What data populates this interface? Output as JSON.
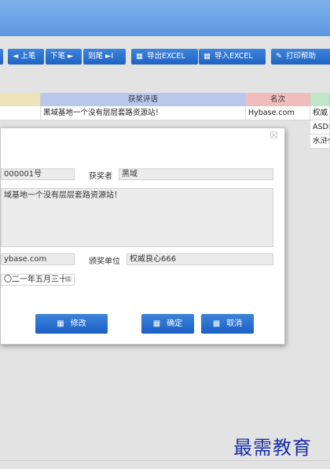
{
  "toolbar": {
    "prev": "◄ 上笔",
    "next": "下笔 ►",
    "last": "到尾 ►I",
    "export": "导出EXCEL",
    "import": "导入EXCEL",
    "print": "打印帮助",
    "grid_icon": "▦",
    "pen_icon": "✎"
  },
  "grid": {
    "headers": [
      "获奖评语",
      "名次"
    ],
    "row1": [
      "黑域基地一个没有层层套路资源站！",
      "Hybase.com",
      "权威"
    ],
    "row2": [
      "ASDF",
      "水浒代"
    ],
    "row2_partial_code": "ASDFASDF"
  },
  "dialog": {
    "close": "☒",
    "number_value": "000001号",
    "winner_label": "获奖者",
    "winner_value": "黑域",
    "comment_value": "域基地一个没有层层套路资源站！",
    "site_value": "ybase.com",
    "award_unit_label": "颁奖单位",
    "award_unit_value": "权威良心666",
    "date_value": "〇二一年五月三十",
    "date_icon": "▦",
    "edit_button": "修改",
    "ok_button": "确定",
    "cancel_button": "取消",
    "button_icon": "▦"
  },
  "watermark": "最需教育"
}
